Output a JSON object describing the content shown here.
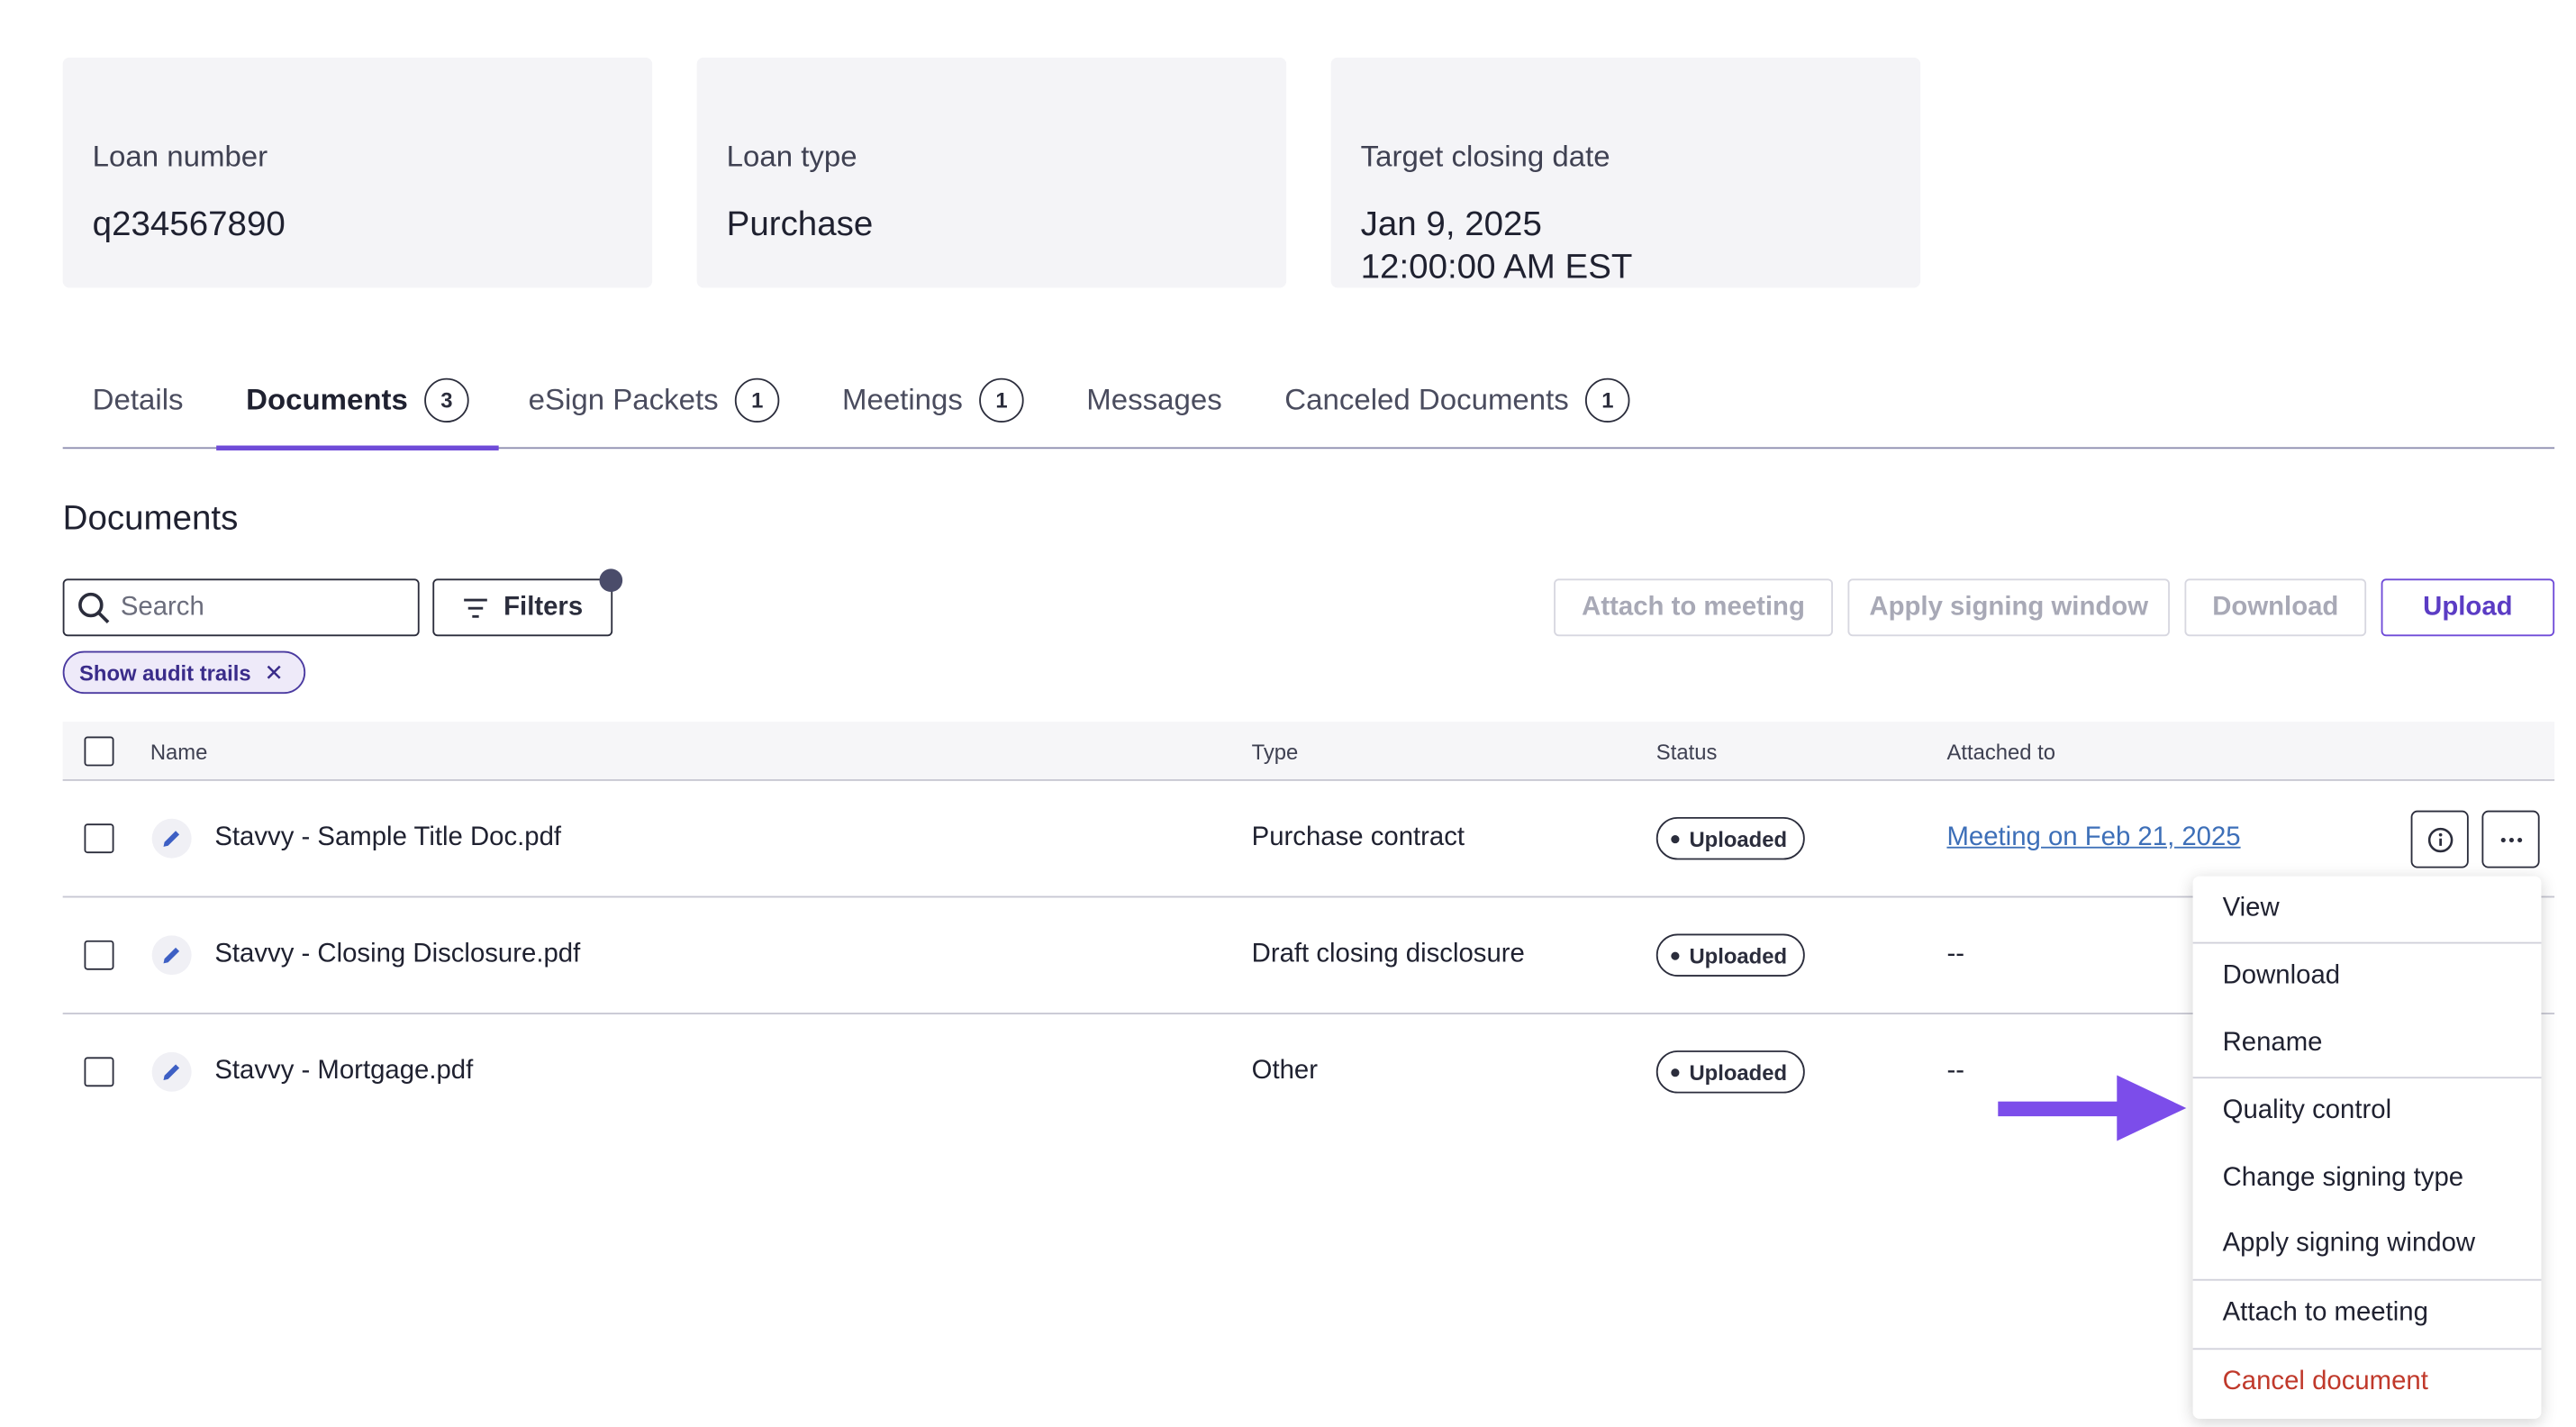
{
  "cards": [
    {
      "label": "Loan number",
      "value": "q234567890"
    },
    {
      "label": "Loan type",
      "value": "Purchase"
    },
    {
      "label": "Target closing date",
      "value": "Jan 9, 2025\n12:00:00 AM EST"
    }
  ],
  "tabs": [
    {
      "label": "Details",
      "count": null
    },
    {
      "label": "Documents",
      "count": "3",
      "active": true
    },
    {
      "label": "eSign Packets",
      "count": "1"
    },
    {
      "label": "Meetings",
      "count": "1"
    },
    {
      "label": "Messages",
      "count": null
    },
    {
      "label": "Canceled Documents",
      "count": "1"
    }
  ],
  "section_title": "Documents",
  "toolbar": {
    "search_placeholder": "Search",
    "filters_label": "Filters",
    "attach_label": "Attach to meeting",
    "apply_window_label": "Apply signing window",
    "download_label": "Download",
    "upload_label": "Upload"
  },
  "chip": {
    "label": "Show audit trails"
  },
  "table": {
    "headers": {
      "name": "Name",
      "type": "Type",
      "status": "Status",
      "attached": "Attached to"
    },
    "rows": [
      {
        "name": "Stavvy - Sample Title Doc.pdf",
        "type": "Purchase contract",
        "status": "Uploaded",
        "attached": "Meeting on Feb 21, 2025"
      },
      {
        "name": "Stavvy - Closing Disclosure.pdf",
        "type": "Draft closing disclosure",
        "status": "Uploaded",
        "attached": "--"
      },
      {
        "name": "Stavvy - Mortgage.pdf",
        "type": "Other",
        "status": "Uploaded",
        "attached": "--"
      }
    ]
  },
  "menu": {
    "items": [
      "View",
      "Download",
      "Rename",
      "Quality control",
      "Change signing type",
      "Apply signing window",
      "Attach to meeting",
      "Cancel document"
    ]
  },
  "colors": {
    "accent": "#6f4bd8",
    "arrow": "#7c4dea",
    "danger": "#c0392b",
    "link": "#3d6fb8"
  }
}
